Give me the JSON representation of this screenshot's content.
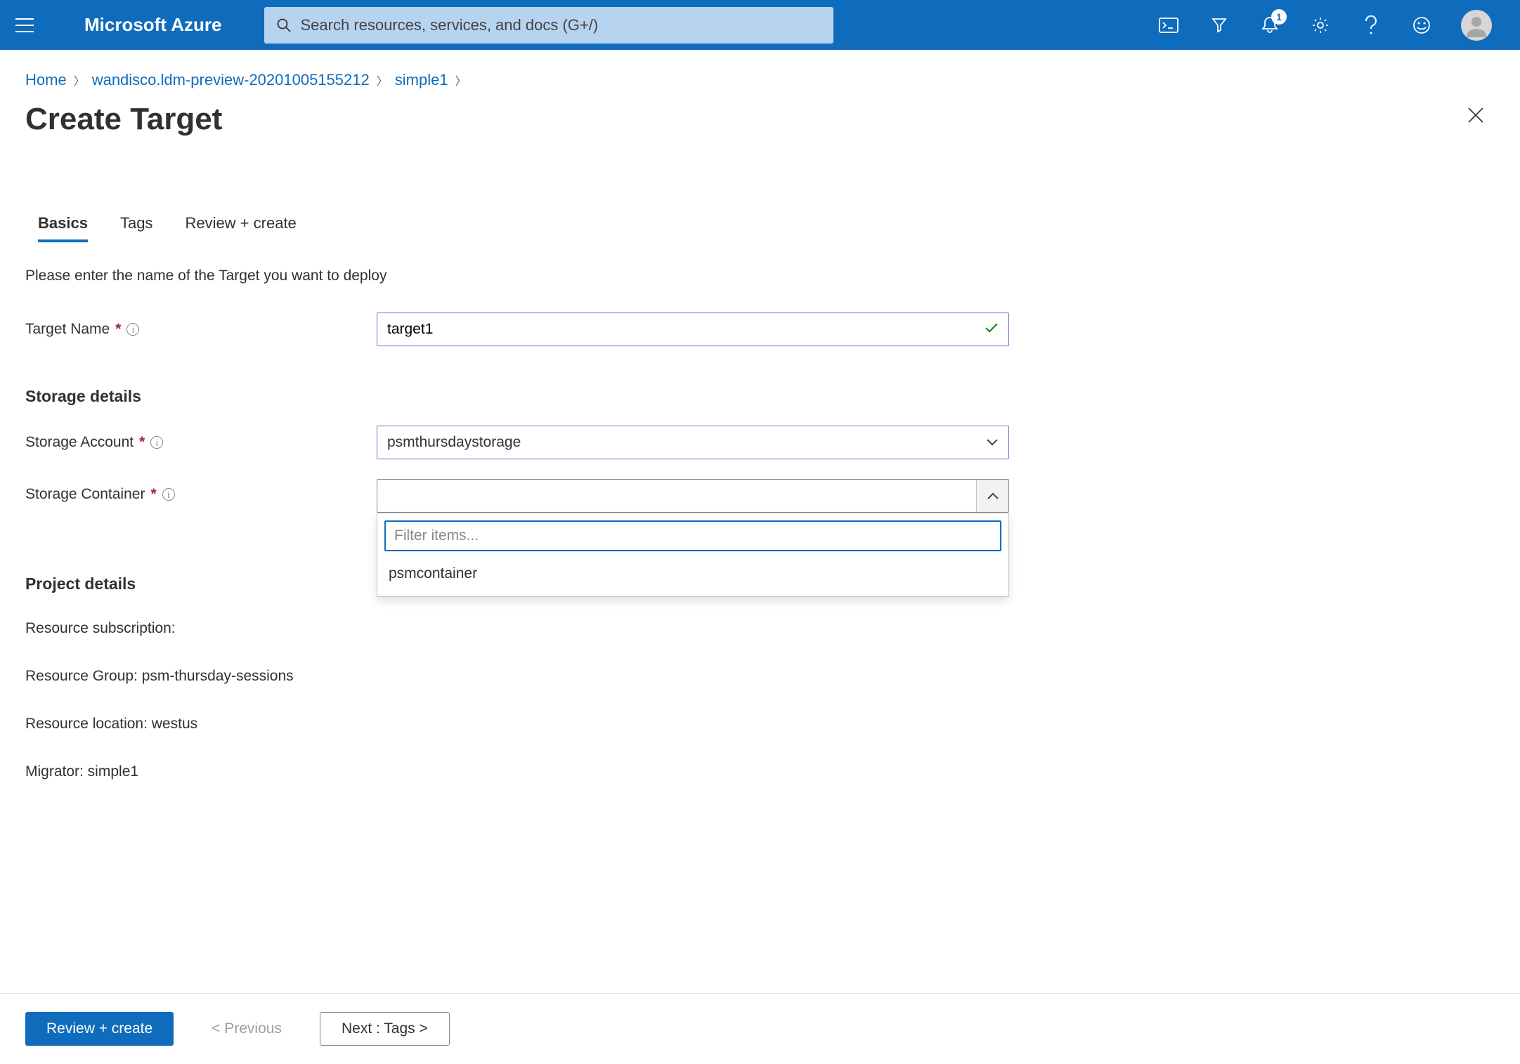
{
  "brand": "Microsoft Azure",
  "search": {
    "placeholder": "Search resources, services, and docs (G+/)"
  },
  "notifications": {
    "count": "1"
  },
  "breadcrumb": {
    "home": "Home",
    "resource": "wandisco.ldm-preview-20201005155212",
    "item": "simple1"
  },
  "page": {
    "title": "Create Target"
  },
  "tabs": {
    "t0": "Basics",
    "t1": "Tags",
    "t2": "Review + create"
  },
  "intro": "Please enter the name of the Target you want to deploy",
  "fields": {
    "targetName": {
      "label": "Target Name",
      "value": "target1"
    },
    "storageAccount": {
      "label": "Storage Account",
      "value": "psmthursdaystorage"
    },
    "storageContainer": {
      "label": "Storage Container",
      "value": ""
    }
  },
  "section": {
    "storage": "Storage details",
    "project": "Project details"
  },
  "dropdown": {
    "filterPlaceholder": "Filter items...",
    "opt0": "psmcontainer"
  },
  "project": {
    "subscription": "Resource subscription:",
    "group": "Resource Group: psm-thursday-sessions",
    "location": "Resource location: westus",
    "migrator": "Migrator: simple1"
  },
  "footer": {
    "review": "Review + create",
    "prev": "< Previous",
    "next": "Next : Tags >"
  }
}
